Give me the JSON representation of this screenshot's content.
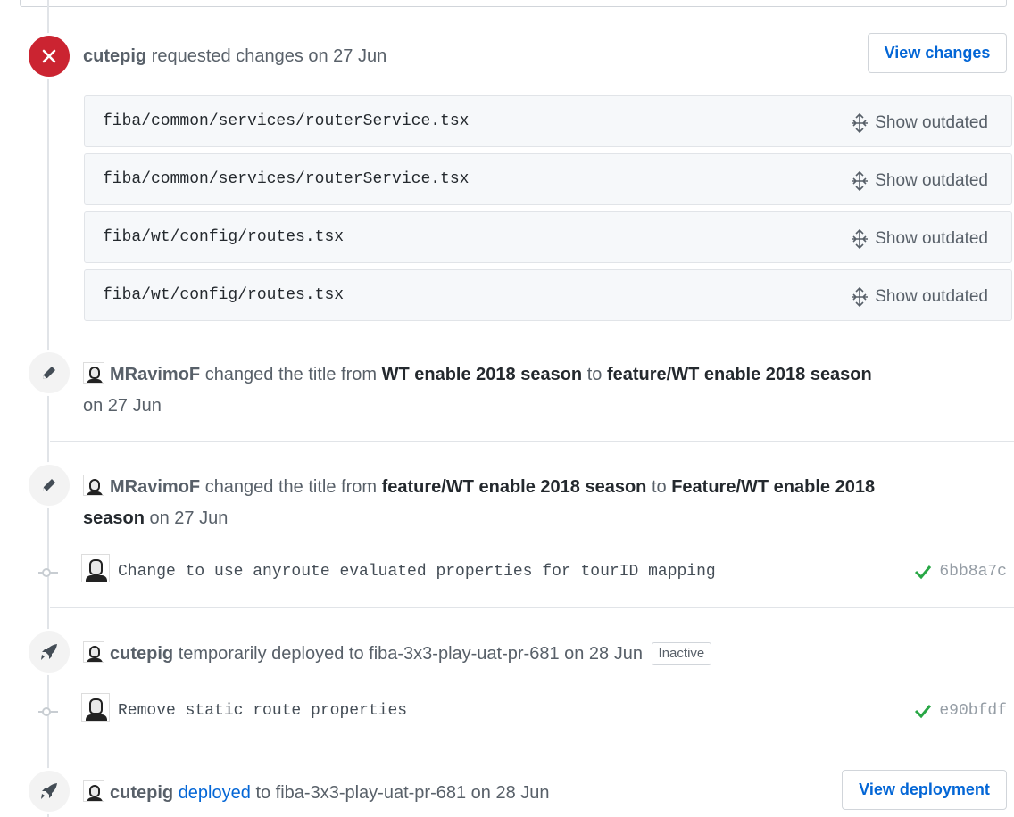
{
  "review": {
    "author": "cutepig",
    "action": "requested changes on 27 Jun",
    "button": "View changes",
    "files": [
      {
        "path": "fiba/common/services/routerService.tsx",
        "action": "Show outdated"
      },
      {
        "path": "fiba/common/services/routerService.tsx",
        "action": "Show outdated"
      },
      {
        "path": "fiba/wt/config/routes.tsx",
        "action": "Show outdated"
      },
      {
        "path": "fiba/wt/config/routes.tsx",
        "action": "Show outdated"
      }
    ]
  },
  "rename1": {
    "author": "MRavimoF",
    "text1": "changed the title from",
    "from": "WT enable 2018 season",
    "to_word": "to",
    "to": "feature/WT enable 2018 season",
    "date": "on 27 Jun"
  },
  "rename2": {
    "author": "MRavimoF",
    "text1": "changed the title from",
    "from": "feature/WT enable 2018 season",
    "to_word": "to",
    "to_line1": "Feature/WT enable 2018",
    "to_line2": "season",
    "date": "on 27 Jun"
  },
  "commit1": {
    "message": "Change to use anyroute evaluated properties for tourID mapping",
    "sha": "6bb8a7c"
  },
  "deploy1": {
    "author": "cutepig",
    "text": "temporarily deployed to fiba-3x3-play-uat-pr-681 on 28 Jun",
    "badge": "Inactive"
  },
  "commit2": {
    "message": "Remove static route properties",
    "sha": "e90bfdf"
  },
  "deploy2": {
    "author": "cutepig",
    "link": "deployed",
    "text": "to fiba-3x3-play-uat-pr-681 on 28 Jun",
    "button": "View deployment"
  },
  "colors": {
    "accent": "#0366d6",
    "danger": "#cb2431",
    "success": "#28a745"
  }
}
